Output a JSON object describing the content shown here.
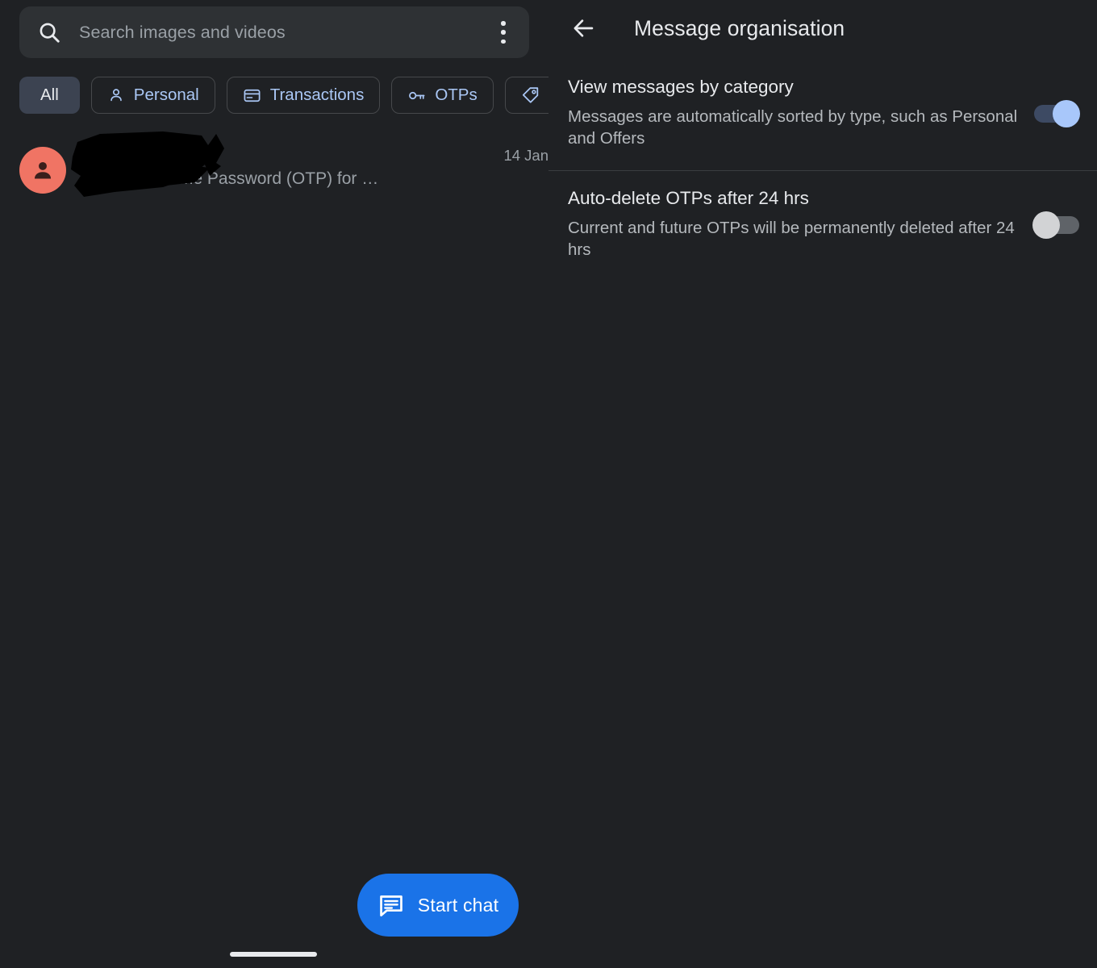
{
  "colors": {
    "background": "#1f2124",
    "search_bar_bg": "#2e3134",
    "chip_text": "#aac7f5",
    "chip_selected_bg": "#3c4351",
    "accent_blue": "#1a73e8",
    "toggle_on_knob": "#a8c7fa",
    "toggle_on_track": "#3d4a63",
    "toggle_off_knob": "#d2d3d5",
    "toggle_off_track": "#5f6368",
    "avatar_bg": "#f07464",
    "primary_text": "#e8eaed",
    "secondary_text": "#9aa0a6"
  },
  "messages_panel": {
    "search": {
      "placeholder": "Search images and videos",
      "search_icon": "search-icon",
      "overflow_icon": "more-vert-icon"
    },
    "filter_chips": [
      {
        "label": "All",
        "icon": "none",
        "selected": true
      },
      {
        "label": "Personal",
        "icon": "person-icon",
        "selected": false
      },
      {
        "label": "Transactions",
        "icon": "credit-card-icon",
        "selected": false
      },
      {
        "label": "OTPs",
        "icon": "key-icon",
        "selected": false
      },
      {
        "label": "",
        "icon": "tag-icon",
        "selected": false
      }
    ],
    "conversations": [
      {
        "sender": "",
        "sender_redacted": true,
        "preview": "is the One Time Password (OTP) for …",
        "date": "14 Jan",
        "avatar_icon": "person-avatar-icon"
      }
    ],
    "fab": {
      "label": "Start chat",
      "icon": "chat-message-icon"
    }
  },
  "settings_panel": {
    "header": {
      "title": "Message organisation",
      "back_icon": "arrow-back-icon"
    },
    "settings": [
      {
        "title": "View messages by category",
        "subtitle": "Messages are automatically sorted by type, such as Personal and Offers",
        "toggle_state": "on"
      },
      {
        "title": "Auto-delete OTPs after 24 hrs",
        "subtitle": "Current and future OTPs will be permanently deleted after 24 hrs",
        "toggle_state": "off"
      }
    ]
  }
}
